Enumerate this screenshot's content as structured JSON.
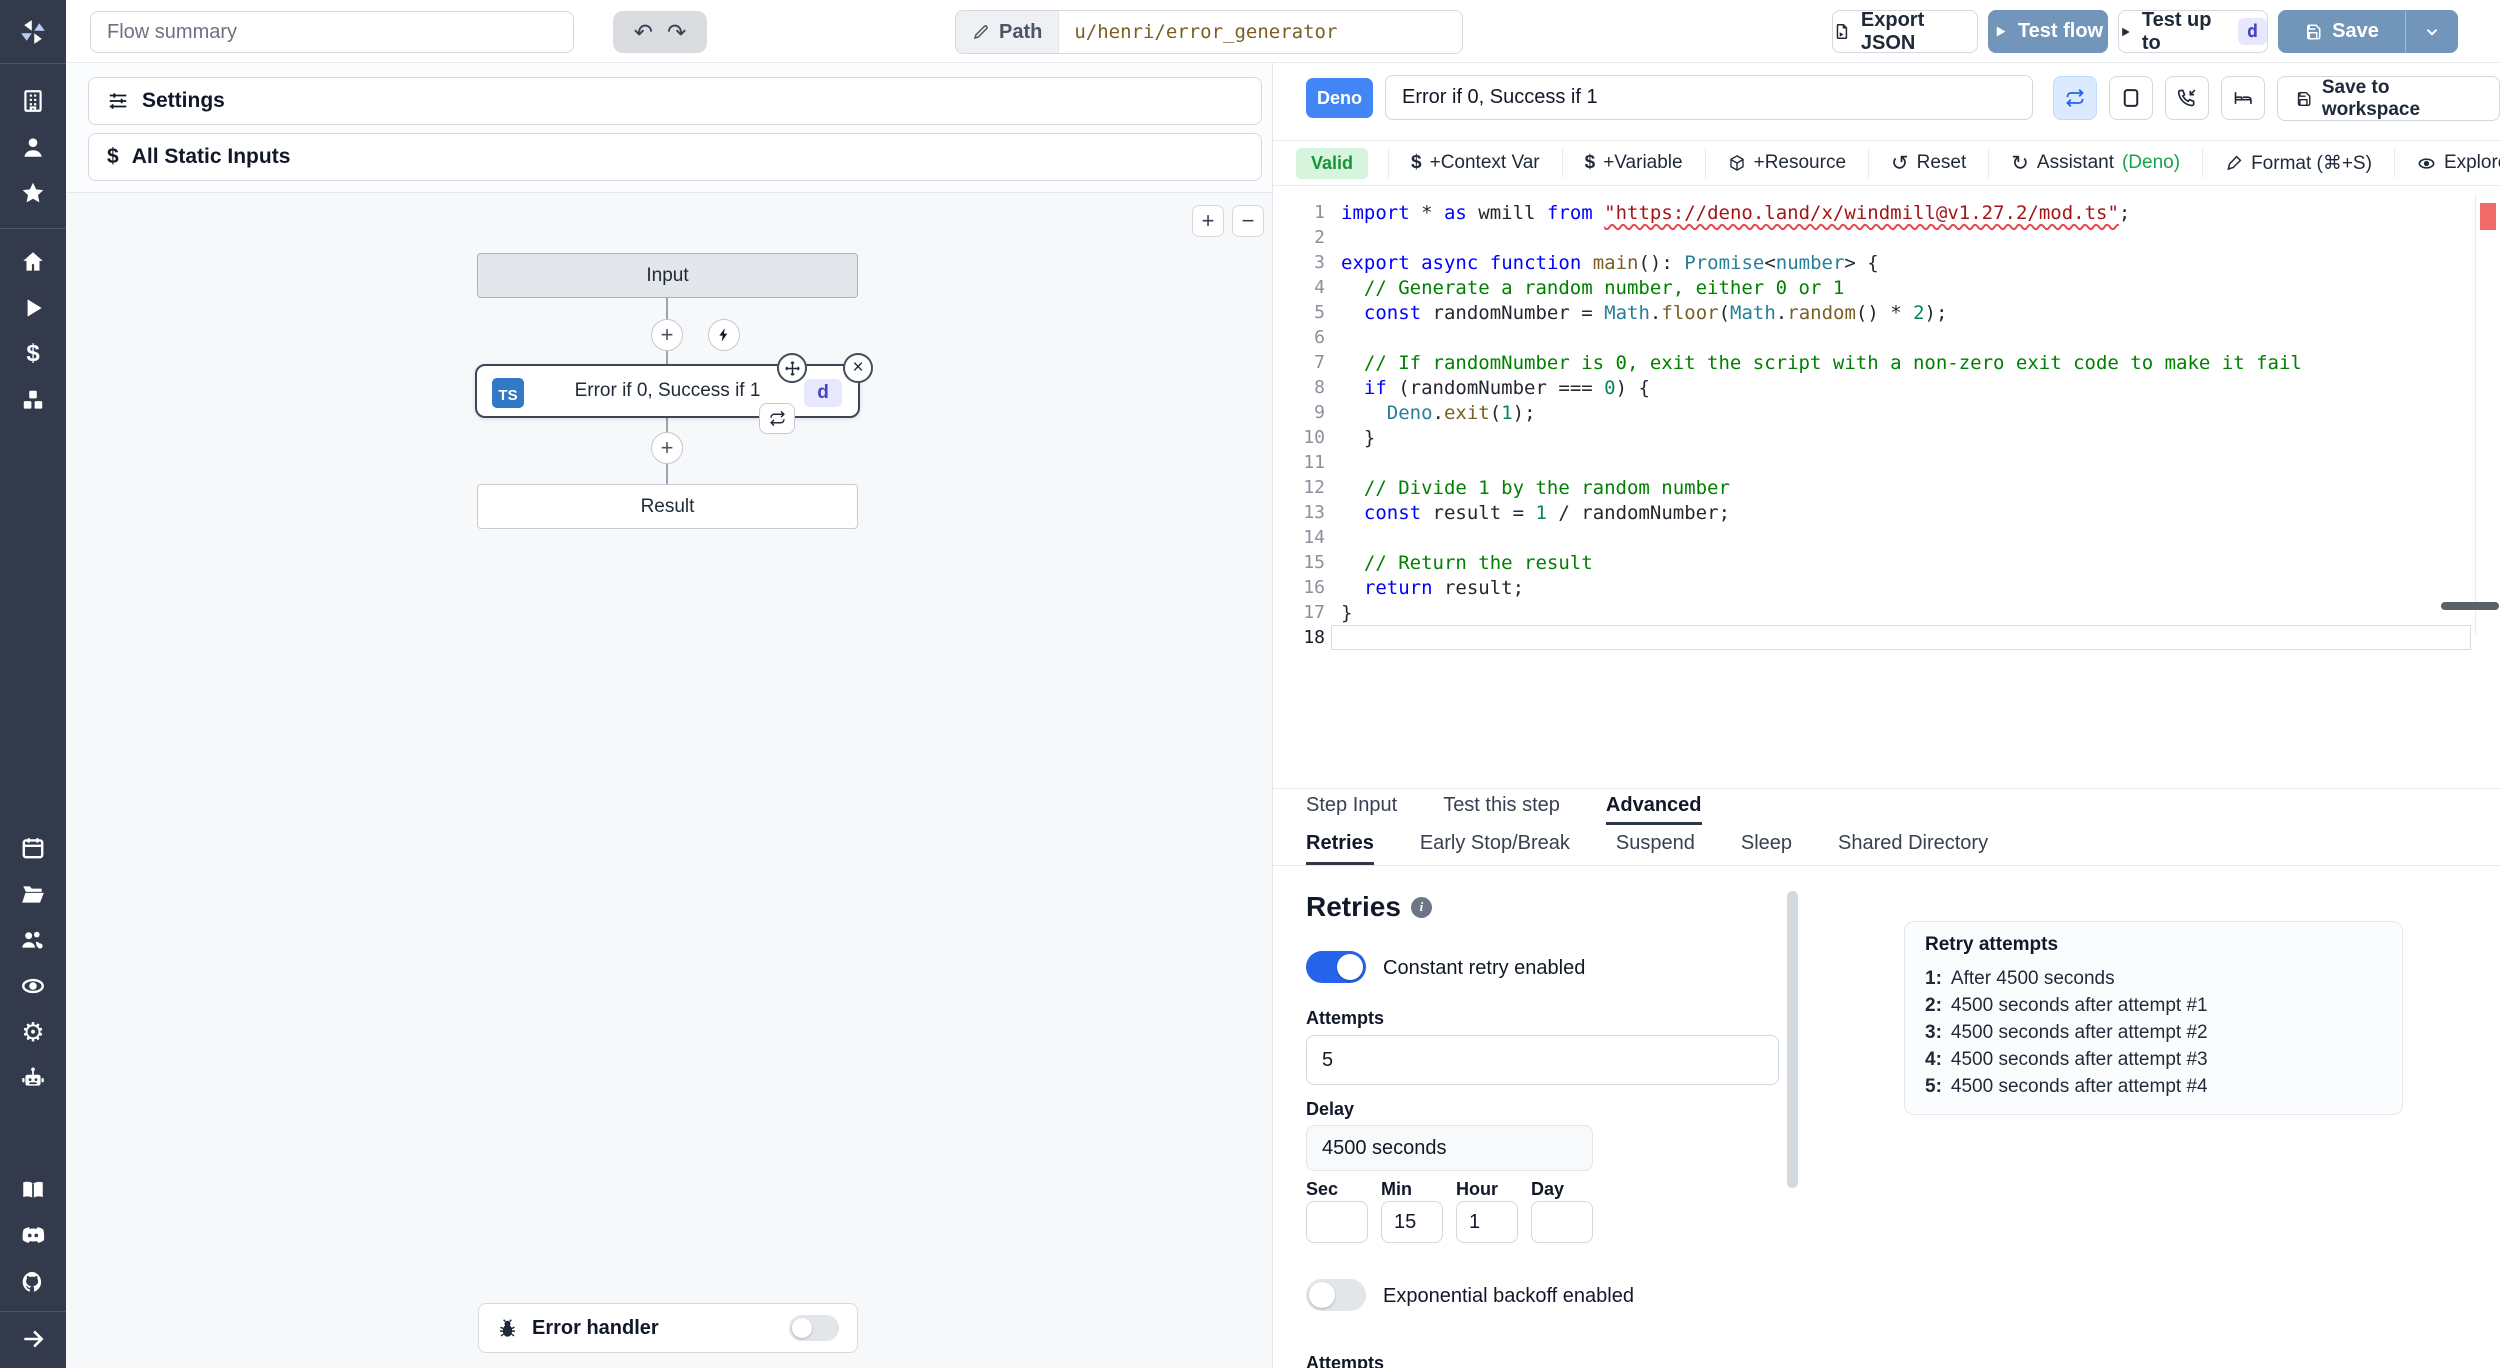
{
  "topbar": {
    "flow_summary_placeholder": "Flow summary",
    "path_label": "Path",
    "path_value": "u/henri/error_generator",
    "export_json_label": "Export JSON",
    "test_flow_label": "Test flow",
    "test_up_to_label": "Test up to",
    "test_up_to_badge": "d",
    "save_label": "Save"
  },
  "sidebar": {
    "icons": [
      "windmill-logo",
      "building",
      "user",
      "star",
      "home",
      "play",
      "dollar",
      "cubes",
      "calendar",
      "folder",
      "user-group",
      "eye",
      "gear",
      "robot",
      "book",
      "discord",
      "github",
      "collapse-arrow"
    ]
  },
  "left_panel": {
    "settings_label": "Settings",
    "all_static_inputs_label": "All Static Inputs",
    "zoom_in": "+",
    "zoom_out": "−",
    "graph": {
      "input_node": "Input",
      "step_node_label": "Error if 0, Success if 1",
      "step_lang_badge": "TS",
      "step_id_badge": "d",
      "result_node": "Result",
      "plus_glyph": "+",
      "close_glyph": "×"
    },
    "error_handler_label": "Error handler"
  },
  "step_editor": {
    "lang_badge": "Deno",
    "title_value": "Error if 0, Success if 1",
    "save_to_workspace_label": "Save to workspace",
    "toolbar": {
      "valid_label": "Valid",
      "dollar": "$",
      "items": [
        "+Context Var",
        "+Variable",
        "+Resource",
        "Reset",
        "Assistant",
        "Format (⌘+S)",
        "Explore other s"
      ],
      "assistant_suffix": "(Deno)"
    }
  },
  "code": {
    "active_line": 18,
    "lines": [
      {
        "n": "1",
        "t": [
          [
            "k",
            "import"
          ],
          [
            "p",
            " * "
          ],
          [
            "k",
            "as"
          ],
          [
            "p",
            " wmill "
          ],
          [
            "k",
            "from"
          ],
          [
            "p",
            " "
          ],
          [
            "s sq",
            "\"https://deno.land/x/windmill@v1.27.2/mod.ts\""
          ],
          [
            "p",
            ";"
          ]
        ]
      },
      {
        "n": "2",
        "t": []
      },
      {
        "n": "3",
        "t": [
          [
            "k",
            "export"
          ],
          [
            "p",
            " "
          ],
          [
            "k",
            "async"
          ],
          [
            "p",
            " "
          ],
          [
            "k",
            "function"
          ],
          [
            "p",
            " "
          ],
          [
            "m",
            "main"
          ],
          [
            "p",
            "(): "
          ],
          [
            "t",
            "Promise"
          ],
          [
            "p",
            "<"
          ],
          [
            "t",
            "number"
          ],
          [
            "p",
            "> {"
          ]
        ]
      },
      {
        "n": "4",
        "t": [
          [
            "c",
            "  // Generate a random number, either 0 or 1"
          ]
        ]
      },
      {
        "n": "5",
        "t": [
          [
            "p",
            "  "
          ],
          [
            "k",
            "const"
          ],
          [
            "p",
            " "
          ],
          [
            "v",
            "randomNumber"
          ],
          [
            "p",
            " = "
          ],
          [
            "t",
            "Math"
          ],
          [
            "p",
            "."
          ],
          [
            "m",
            "floor"
          ],
          [
            "p",
            "("
          ],
          [
            "t",
            "Math"
          ],
          [
            "p",
            "."
          ],
          [
            "m",
            "random"
          ],
          [
            "p",
            "() * "
          ],
          [
            "n",
            "2"
          ],
          [
            "p",
            ");"
          ]
        ]
      },
      {
        "n": "6",
        "t": []
      },
      {
        "n": "7",
        "t": [
          [
            "c",
            "  // If randomNumber is 0, exit the script with a non-zero exit code to make it fail"
          ]
        ]
      },
      {
        "n": "8",
        "t": [
          [
            "p",
            "  "
          ],
          [
            "k",
            "if"
          ],
          [
            "p",
            " ("
          ],
          [
            "v",
            "randomNumber"
          ],
          [
            "p",
            " === "
          ],
          [
            "n",
            "0"
          ],
          [
            "p",
            ") {"
          ]
        ]
      },
      {
        "n": "9",
        "t": [
          [
            "p",
            "    "
          ],
          [
            "t",
            "Deno"
          ],
          [
            "p",
            "."
          ],
          [
            "m",
            "exit"
          ],
          [
            "p",
            "("
          ],
          [
            "n",
            "1"
          ],
          [
            "p",
            ");"
          ]
        ]
      },
      {
        "n": "10",
        "t": [
          [
            "p",
            "  }"
          ]
        ]
      },
      {
        "n": "11",
        "t": []
      },
      {
        "n": "12",
        "t": [
          [
            "c",
            "  // Divide 1 by the random number"
          ]
        ]
      },
      {
        "n": "13",
        "t": [
          [
            "p",
            "  "
          ],
          [
            "k",
            "const"
          ],
          [
            "p",
            " "
          ],
          [
            "v",
            "result"
          ],
          [
            "p",
            " = "
          ],
          [
            "n",
            "1"
          ],
          [
            "p",
            " / "
          ],
          [
            "v",
            "randomNumber"
          ],
          [
            "p",
            ";"
          ]
        ]
      },
      {
        "n": "14",
        "t": []
      },
      {
        "n": "15",
        "t": [
          [
            "c",
            "  // Return the result"
          ]
        ]
      },
      {
        "n": "16",
        "t": [
          [
            "p",
            "  "
          ],
          [
            "k",
            "return"
          ],
          [
            "p",
            " "
          ],
          [
            "v",
            "result"
          ],
          [
            "p",
            ";"
          ]
        ]
      },
      {
        "n": "17",
        "t": [
          [
            "p",
            "}"
          ]
        ]
      },
      {
        "n": "18",
        "t": []
      }
    ]
  },
  "tabs": {
    "main": [
      "Step Input",
      "Test this step",
      "Advanced"
    ],
    "sub": [
      "Retries",
      "Early Stop/Break",
      "Suspend",
      "Sleep",
      "Shared Directory"
    ]
  },
  "retries": {
    "heading": "Retries",
    "constant_label": "Constant retry enabled",
    "attempts_label": "Attempts",
    "attempts_value": "5",
    "delay_label": "Delay",
    "delay_value": "4500 seconds",
    "durations": [
      {
        "label": "Sec",
        "value": ""
      },
      {
        "label": "Min",
        "value": "15"
      },
      {
        "label": "Hour",
        "value": "1"
      },
      {
        "label": "Day",
        "value": ""
      }
    ],
    "exponential_label": "Exponential backoff enabled",
    "clipped_label": "Attempts",
    "panel": {
      "title": "Retry attempts",
      "items": [
        {
          "n": "1:",
          "text": "After 4500 seconds"
        },
        {
          "n": "2:",
          "text": "4500 seconds after attempt #1"
        },
        {
          "n": "3:",
          "text": "4500 seconds after attempt #2"
        },
        {
          "n": "4:",
          "text": "4500 seconds after attempt #3"
        },
        {
          "n": "5:",
          "text": "4500 seconds after attempt #4"
        }
      ]
    }
  }
}
